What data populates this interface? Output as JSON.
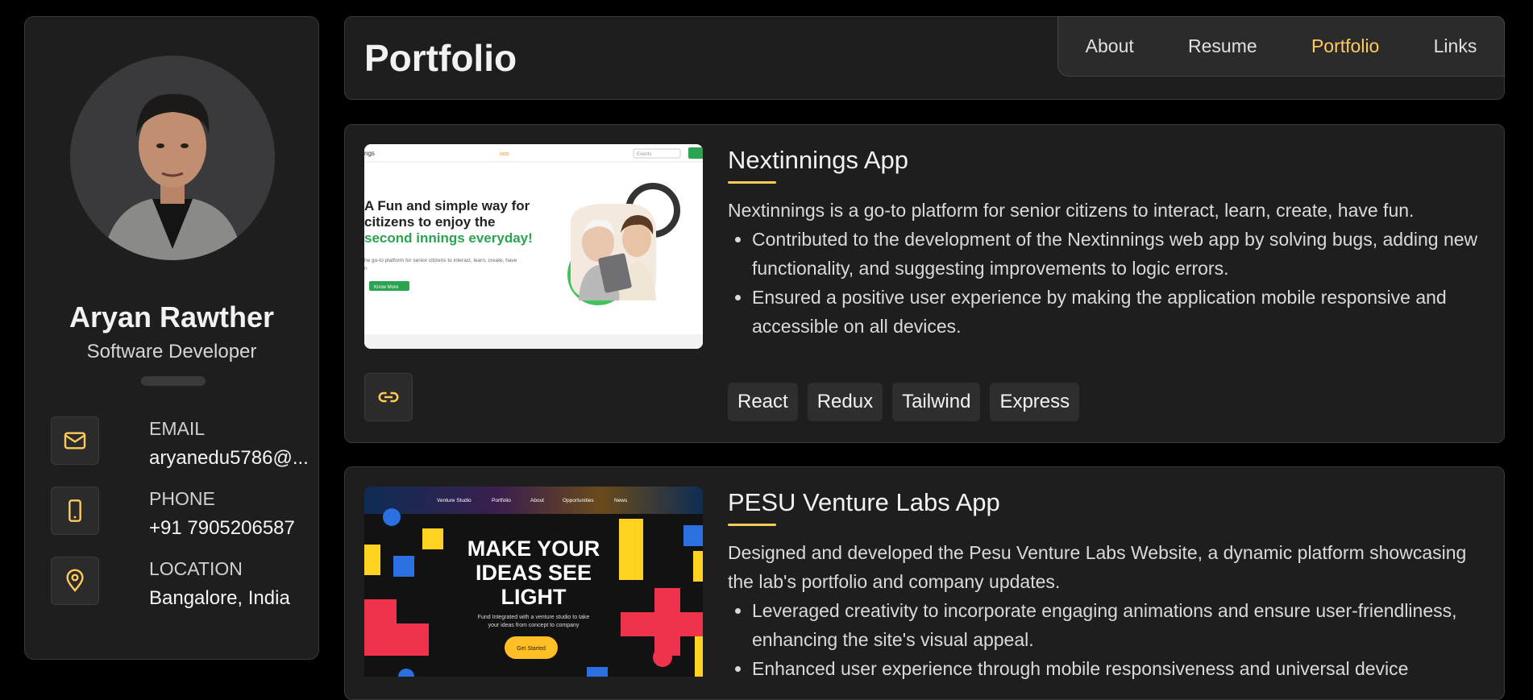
{
  "profile": {
    "name": "Aryan Rawther",
    "title": "Software Developer",
    "contacts": [
      {
        "label": "EMAIL",
        "value": "aryanedu5786@...",
        "icon": "mail-icon"
      },
      {
        "label": "PHONE",
        "value": "+91 7905206587",
        "icon": "phone-icon"
      },
      {
        "label": "LOCATION",
        "value": "Bangalore, India",
        "icon": "location-icon"
      }
    ]
  },
  "header": {
    "title": "Portfolio",
    "nav": [
      "About",
      "Resume",
      "Portfolio",
      "Links"
    ],
    "active": "Portfolio"
  },
  "projects": [
    {
      "title": "Nextinnings App",
      "summary": "Nextinnings is a go-to platform for senior citizens to interact, learn, create, have fun.",
      "bullets": [
        "Contributed to the development of the Nextinnings web app by solving bugs, adding new functionality, and suggesting improvements to logic errors.",
        "Ensured a positive user experience by making the application mobile responsive and accessible on all devices."
      ],
      "tags": [
        "React",
        "Redux",
        "Tailwind",
        "Express"
      ],
      "screenshot": {
        "logo_fragment": "ngs",
        "nav_text": "Events",
        "headline_1": "A Fun and simple way for",
        "headline_2": "citizens to enjoy the",
        "headline_3": "second innings everyday!",
        "subtext": "he go-to platform for senior citizens to interact, learn, create, have",
        "subtext_2": "n",
        "cta": "Know More"
      }
    },
    {
      "title": "PESU Venture Labs App",
      "summary": "Designed and developed the Pesu Venture Labs Website, a dynamic platform showcasing the lab's portfolio and company updates.",
      "bullets": [
        "Leveraged creativity to incorporate engaging animations and ensure user-friendliness, enhancing the site's visual appeal.",
        "Enhanced user experience through mobile responsiveness and universal device"
      ],
      "screenshot": {
        "nav": [
          "Venture Studio",
          "Portfolio",
          "About",
          "Opportunities",
          "News"
        ],
        "headline_1": "MAKE YOUR",
        "headline_2": "IDEAS SEE",
        "headline_3": "LIGHT",
        "subtext_1": "Fund Integrated with a venture studio to take",
        "subtext_2": "your ideas from concept to company",
        "cta": "Get Started"
      }
    }
  ],
  "colors": {
    "accent": "#ffcb5b",
    "card": "#1e1e1f",
    "green": "#2aa44f"
  }
}
